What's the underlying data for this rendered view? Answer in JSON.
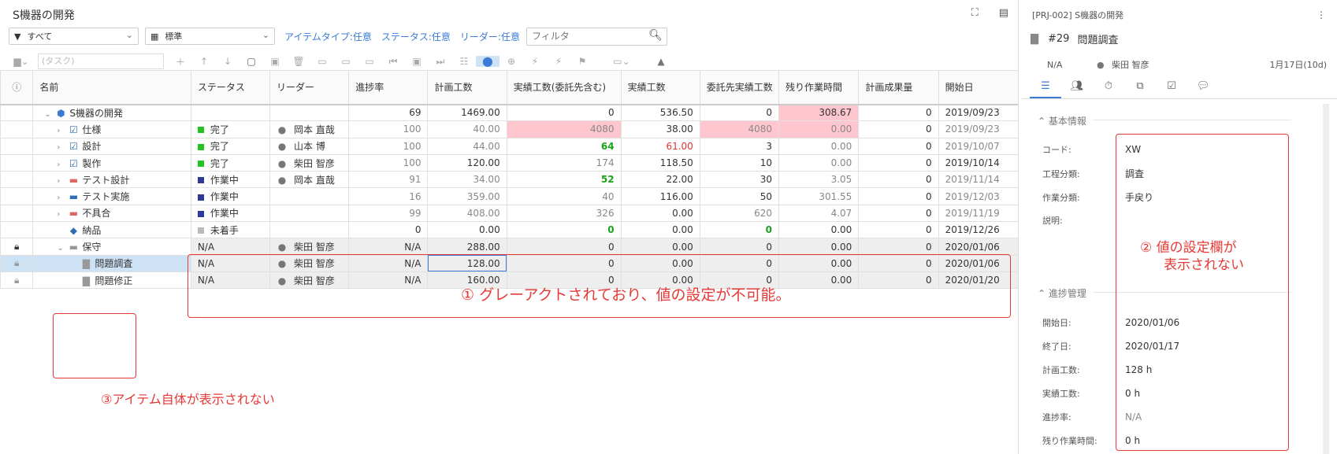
{
  "app": {
    "title": "S機器の開発"
  },
  "filters": {
    "scope": "すべて",
    "view": "標準",
    "item_type": "アイテムタイプ:任意",
    "status": "ステータス:任意",
    "leader": "リーダー:任意",
    "filter_placeholder": "フィルタ"
  },
  "toolbar": {
    "task_placeholder": "(タスク)"
  },
  "columns": [
    "名前",
    "ステータス",
    "リーダー",
    "進捗率",
    "計画工数",
    "実績工数(委託先含む)",
    "実績工数",
    "委託先実績工数",
    "残り作業時間",
    "計画成果量",
    "開始日"
  ],
  "rows": [
    {
      "name": "S機器の開発",
      "status": "",
      "leader": "",
      "progress": "69",
      "plan": "1469.00",
      "actual_all": "0",
      "actual": "536.50",
      "vendor": "0",
      "remain": "308.67",
      "output": "0",
      "start": "2019/09/23"
    },
    {
      "name": "仕様",
      "status": "完了",
      "leader": "岡本 直哉",
      "progress": "100",
      "plan": "40.00",
      "actual_all": "4080",
      "actual": "38.00",
      "vendor": "4080",
      "remain": "0.00",
      "output": "0",
      "start": "2019/09/23"
    },
    {
      "name": "設計",
      "status": "完了",
      "leader": "山本 博",
      "progress": "100",
      "plan": "44.00",
      "actual_all": "64",
      "actual": "61.00",
      "vendor": "3",
      "remain": "0.00",
      "output": "0",
      "start": "2019/10/07"
    },
    {
      "name": "製作",
      "status": "完了",
      "leader": "柴田 智彦",
      "progress": "100",
      "plan": "120.00",
      "actual_all": "174",
      "actual": "118.50",
      "vendor": "10",
      "remain": "0.00",
      "output": "0",
      "start": "2019/10/14"
    },
    {
      "name": "テスト設計",
      "status": "作業中",
      "leader": "岡本 直哉",
      "progress": "91",
      "plan": "34.00",
      "actual_all": "52",
      "actual": "22.00",
      "vendor": "30",
      "remain": "3.05",
      "output": "0",
      "start": "2019/11/14"
    },
    {
      "name": "テスト実施",
      "status": "作業中",
      "leader": "",
      "progress": "16",
      "plan": "359.00",
      "actual_all": "40",
      "actual": "116.00",
      "vendor": "50",
      "remain": "301.55",
      "output": "0",
      "start": "2019/12/03"
    },
    {
      "name": "不具合",
      "status": "作業中",
      "leader": "",
      "progress": "99",
      "plan": "408.00",
      "actual_all": "326",
      "actual": "0.00",
      "vendor": "620",
      "remain": "4.07",
      "output": "0",
      "start": "2019/11/19"
    },
    {
      "name": "納品",
      "status": "未着手",
      "leader": "",
      "progress": "0",
      "plan": "0.00",
      "actual_all": "0",
      "actual": "0.00",
      "vendor": "0",
      "remain": "0.00",
      "output": "0",
      "start": "2019/12/26"
    },
    {
      "name": "保守",
      "status": "N/A",
      "leader": "柴田 智彦",
      "progress": "N/A",
      "plan": "288.00",
      "actual_all": "0",
      "actual": "0.00",
      "vendor": "0",
      "remain": "0.00",
      "output": "0",
      "start": "2020/01/06"
    },
    {
      "name": "問題調査",
      "status": "N/A",
      "leader": "柴田 智彦",
      "progress": "N/A",
      "plan": "128.00",
      "actual_all": "0",
      "actual": "0.00",
      "vendor": "0",
      "remain": "0.00",
      "output": "0",
      "start": "2020/01/06"
    },
    {
      "name": "問題修正",
      "status": "N/A",
      "leader": "柴田 智彦",
      "progress": "N/A",
      "plan": "160.00",
      "actual_all": "0",
      "actual": "0.00",
      "vendor": "0",
      "remain": "0.00",
      "output": "0",
      "start": "2020/01/20"
    }
  ],
  "annotations": {
    "a1": "① グレーアクトされており、値の設定が不可能。",
    "a2_line1": "② 値の設定欄が",
    "a2_line2": "表示されない",
    "a3": "③アイテム自体が表示されない"
  },
  "detail": {
    "header": "[PRJ-002] S機器の開発",
    "task_id": "#29",
    "task_name": "問題調査",
    "status": "N/A",
    "leader": "柴田 智彦",
    "due": "1月17日(10d)",
    "sec_basic": "基本情報",
    "code_label": "コード:",
    "code_value": "XW",
    "process_label": "工程分類:",
    "process_value": "調査",
    "work_label": "作業分類:",
    "work_value": "手戻り",
    "desc_label": "説明:",
    "sec_progress": "進捗管理",
    "start_label": "開始日:",
    "start_value": "2020/01/06",
    "end_label": "終了日:",
    "end_value": "2020/01/17",
    "plan_label": "計画工数:",
    "plan_value": "128 h",
    "actual_label": "実績工数:",
    "actual_value": "0 h",
    "rate_label": "進捗率:",
    "rate_value": "N/A",
    "remain_label": "残り作業時間:",
    "remain_value": "0 h"
  },
  "colors": {
    "accent": "#3a7bd5",
    "annotation": "#e53935",
    "done": "#22c322",
    "working": "#2b3a9b",
    "todo": "#bbbbbb",
    "overrun": "#ffc6d0"
  }
}
